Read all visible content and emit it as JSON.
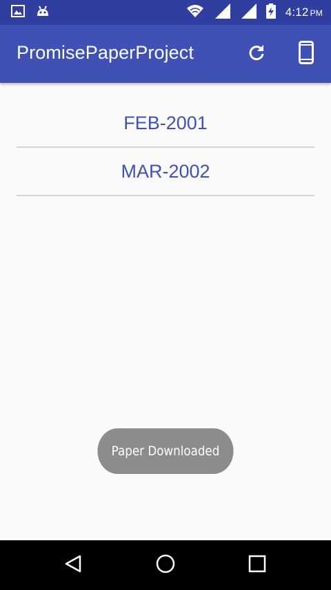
{
  "status_bar": {
    "time": "4:12",
    "ampm": "PM",
    "left_icons": [
      "image-notification-icon",
      "android-notification-icon"
    ],
    "right_icons": [
      "wifi-icon",
      "signal-1-icon",
      "signal-2-icon",
      "battery-charging-icon"
    ]
  },
  "app_bar": {
    "title": "PromisePaperProject",
    "actions": [
      "refresh-icon",
      "phone-icon"
    ],
    "color": "#3f51b5",
    "status_color": "#303f9f"
  },
  "list": {
    "items": [
      {
        "label": "FEB-2001"
      },
      {
        "label": "MAR-2002"
      }
    ],
    "text_color": "#3f51b5"
  },
  "toast": {
    "message": "Paper Downloaded"
  },
  "nav_bar": {
    "buttons": [
      "back-icon",
      "home-icon",
      "recents-icon"
    ]
  }
}
